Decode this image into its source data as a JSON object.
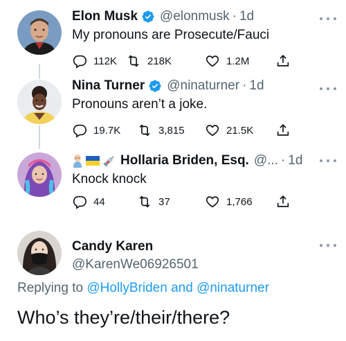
{
  "tweets": [
    {
      "name": "Elon Musk",
      "handle": "@elonmusk",
      "dot": "·",
      "time": "1d",
      "text": "My pronouns are Prosecute/Fauci",
      "replies": "112K",
      "retweets": "218K",
      "likes": "1.2M",
      "verified": true
    },
    {
      "name": "Nina Turner",
      "handle": "@ninaturner",
      "dot": "·",
      "time": "1d",
      "text": "Pronouns aren’t a joke.",
      "replies": "19.7K",
      "retweets": "3,815",
      "likes": "21.5K",
      "verified": true
    },
    {
      "name": "Hollaria Briden, Esq.",
      "handle": "@...",
      "dot": "·",
      "time": "1d",
      "text": "Knock knock",
      "replies": "44",
      "retweets": "37",
      "likes": "1,766",
      "verified": false
    }
  ],
  "reply": {
    "name": "Candy Karen",
    "handle": "@KarenWe06926501",
    "replying_prefix": "Replying to",
    "mention_1": "@HollyBriden",
    "and": "and",
    "mention_2": "@ninaturner",
    "text": "Who’s they’re/their/there?"
  },
  "colors": {
    "verified": "#1d9bf0",
    "link": "#1d9bf0",
    "secondary_text": "#536471",
    "thread_line": "#cfd9de"
  },
  "icons": [
    "reply-icon",
    "retweet-icon",
    "like-icon",
    "share-icon",
    "verified-badge-icon",
    "more-icon",
    "baby-emoji-icon",
    "ukraine-flag-icon",
    "syringe-emoji-icon"
  ]
}
